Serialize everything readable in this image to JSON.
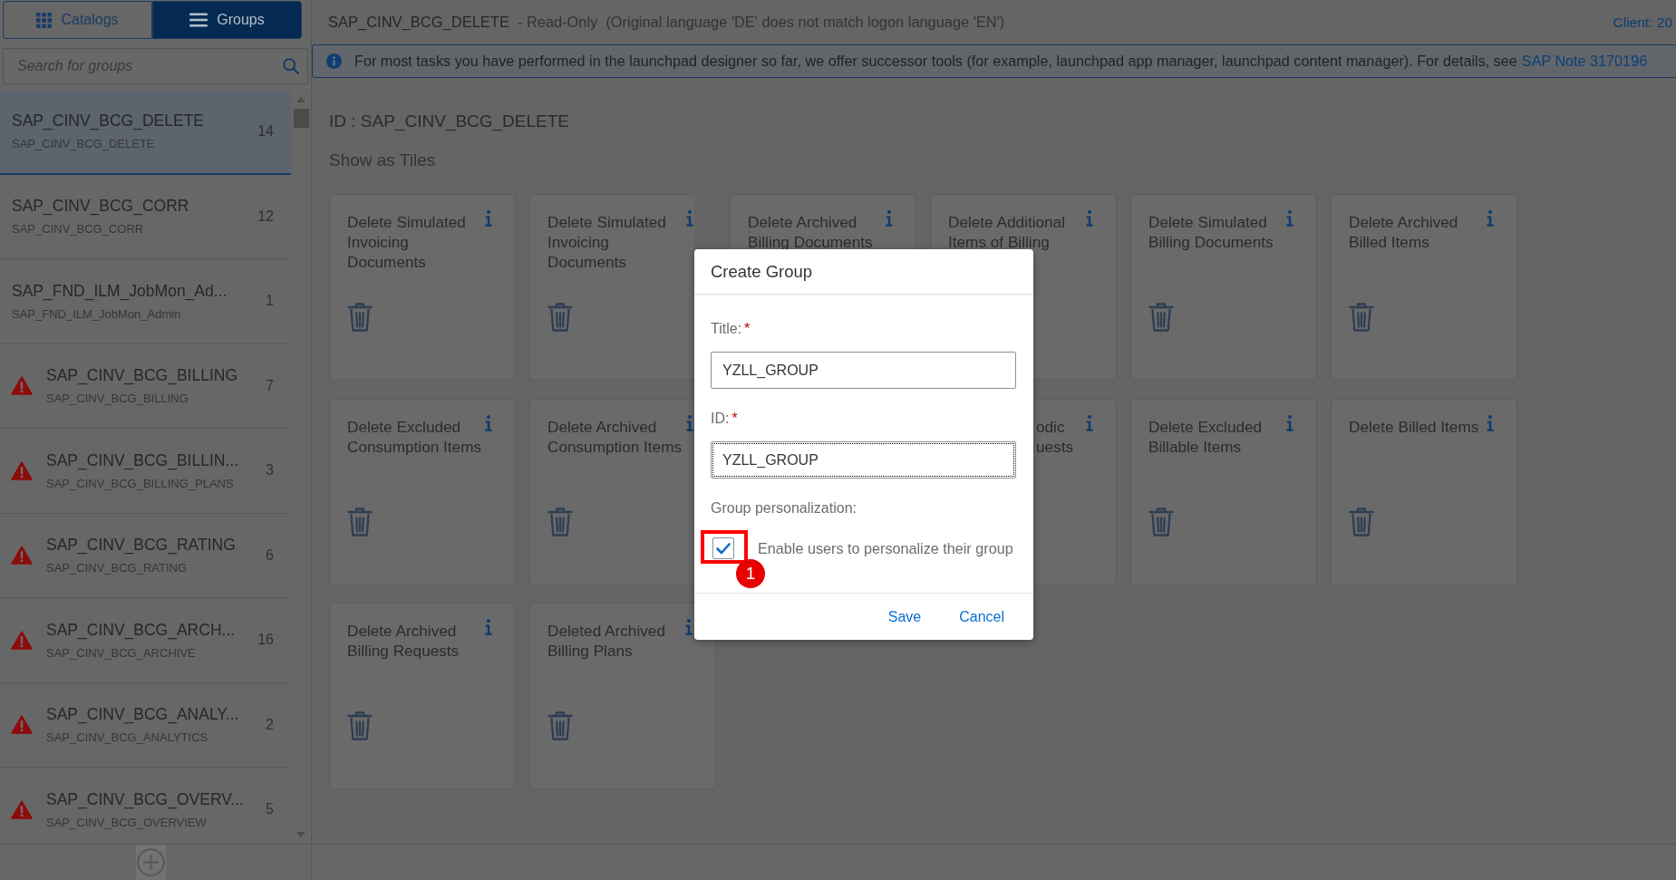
{
  "header": {
    "title": "SAP_CINV_BCG_DELETE",
    "note": "- Read-Only  (Original language 'DE' does not match logon language 'EN')",
    "client": "Client: 20"
  },
  "sidebar": {
    "tabs": [
      {
        "label": "Catalogs",
        "kind": "grid",
        "selected": false
      },
      {
        "label": "Groups",
        "kind": "list",
        "selected": true
      }
    ],
    "search": {
      "placeholder": "Search for groups"
    },
    "groups": [
      {
        "title": "SAP_CINV_BCG_DELETE",
        "subtitle": "SAP_CINV_BCG_DELETE",
        "count": "14",
        "warning": false,
        "selected": true
      },
      {
        "title": "SAP_CINV_BCG_CORR",
        "subtitle": "SAP_CINV_BCG_CORR",
        "count": "12",
        "warning": false,
        "selected": false
      },
      {
        "title": "SAP_FND_ILM_JobMon_Ad...",
        "subtitle": "SAP_FND_ILM_JobMon_Admin",
        "count": "1",
        "warning": false,
        "selected": false
      },
      {
        "title": "SAP_CINV_BCG_BILLING",
        "subtitle": "SAP_CINV_BCG_BILLING",
        "count": "7",
        "warning": true,
        "selected": false
      },
      {
        "title": "SAP_CINV_BCG_BILLIN...",
        "subtitle": "SAP_CINV_BCG_BILLING_PLANS",
        "count": "3",
        "warning": true,
        "selected": false
      },
      {
        "title": "SAP_CINV_BCG_RATING",
        "subtitle": "SAP_CINV_BCG_RATING",
        "count": "6",
        "warning": true,
        "selected": false
      },
      {
        "title": "SAP_CINV_BCG_ARCH...",
        "subtitle": "SAP_CINV_BCG_ARCHIVE",
        "count": "16",
        "warning": true,
        "selected": false
      },
      {
        "title": "SAP_CINV_BCG_ANALY...",
        "subtitle": "SAP_CINV_BCG_ANALYTICS",
        "count": "2",
        "warning": true,
        "selected": false
      },
      {
        "title": "SAP_CINV_BCG_OVERV...",
        "subtitle": "SAP_CINV_BCG_OVERVIEW",
        "count": "5",
        "warning": true,
        "selected": false
      }
    ]
  },
  "banner": {
    "text": "For most tasks you have performed in the launchpad designer so far, we offer successor tools (for example, launchpad app manager, launchpad content manager). For details, see",
    "link": "SAP Note 3170196"
  },
  "content": {
    "id_line": "ID : SAP_CINV_BCG_DELETE",
    "section": "Show as Tiles",
    "tile_rows": [
      [
        {
          "title": "Delete Simulated\nInvoicing\nDocuments",
          "kind": "full"
        },
        {
          "title": "Delete Simulated\nInvoicing\nDocuments",
          "kind": "cut"
        },
        {
          "title": "Delete Archived\nBilling Documents",
          "kind": "strip"
        },
        {
          "title": "Delete Additional\nItems of Billing",
          "kind": "top"
        },
        {
          "title": "Delete Simulated\nBilling Documents",
          "kind": "full"
        },
        {
          "title": "Delete Archived\nBilled Items",
          "kind": "full"
        }
      ],
      [
        {
          "title": "Delete Excluded\nConsumption Items",
          "kind": "full"
        },
        {
          "title": "Delete Archived\nConsumption Items",
          "kind": "cut"
        },
        {
          "title": "odic\nuests",
          "kind": "fragment"
        },
        {
          "title": "Delete Excluded\nBillable Items",
          "kind": "full"
        },
        {
          "title": "Delete Billed Items",
          "kind": "full"
        }
      ],
      [
        {
          "title": "Delete Archived\nBilling Requests",
          "kind": "full"
        },
        {
          "title": "Deleted Archived\nBilling Plans",
          "kind": "full"
        }
      ]
    ]
  },
  "dialog": {
    "title": "Create Group",
    "fields": [
      {
        "label": "Title:",
        "required_mark": "*",
        "value": "YZLL_GROUP",
        "focused": false
      },
      {
        "label": "ID:",
        "required_mark": "*",
        "value": "YZLL_GROUP",
        "focused": true
      }
    ],
    "personalization": {
      "label": "Group personalization:",
      "checkbox_label": "Enable users to personalize their group",
      "checked": true
    },
    "buttons": [
      "Save",
      "Cancel"
    ]
  },
  "annotation": {
    "step": "1"
  }
}
